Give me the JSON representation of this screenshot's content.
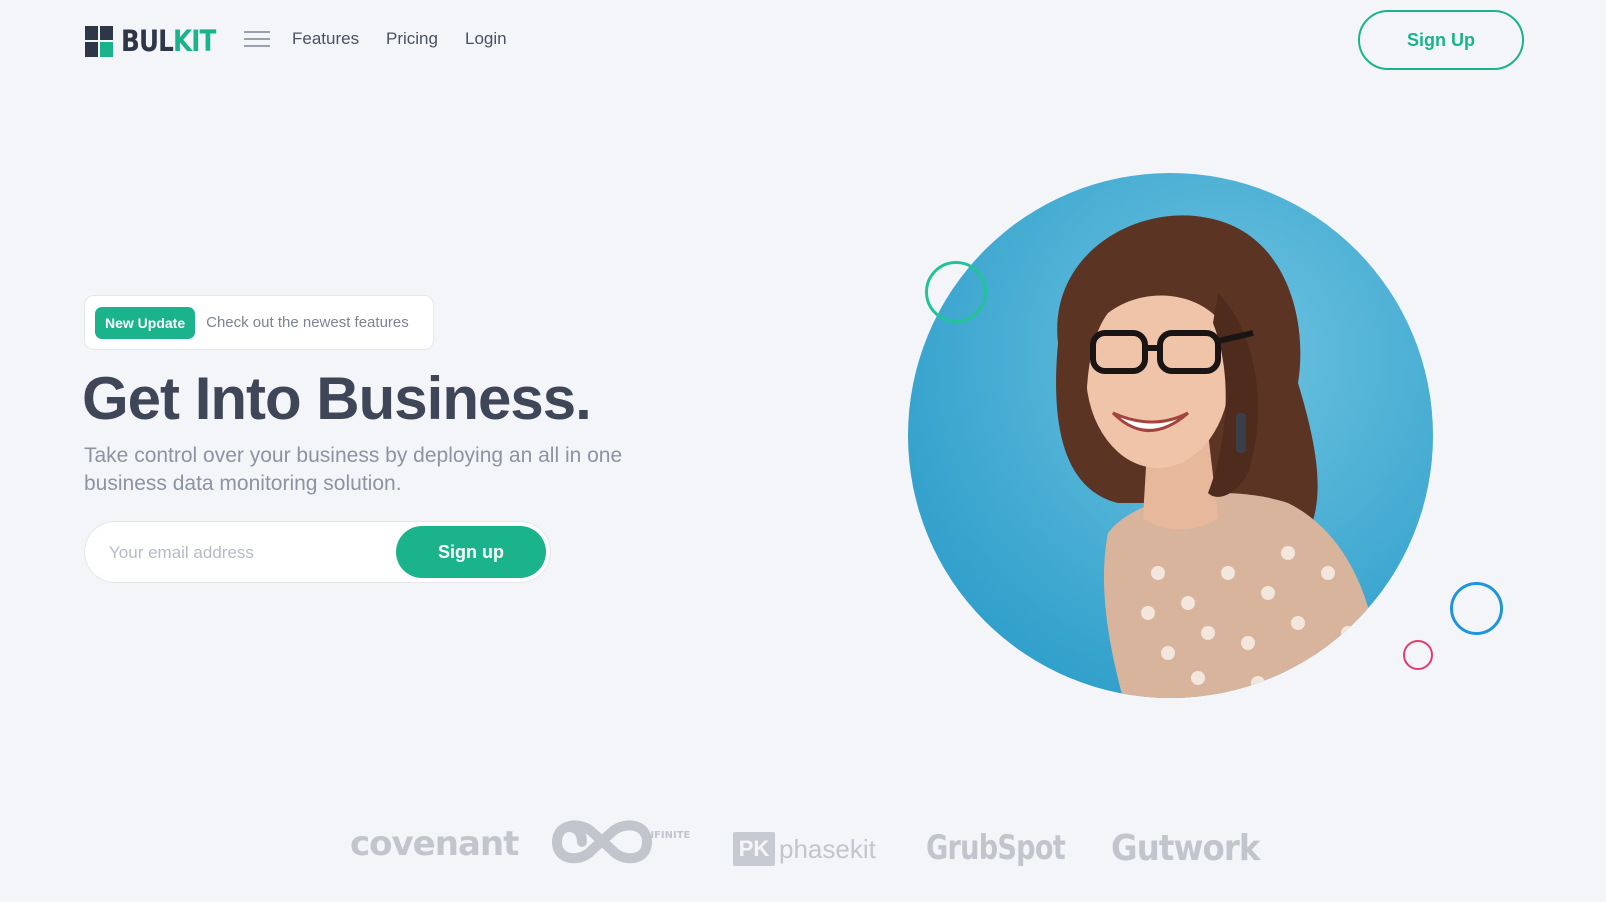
{
  "brand": {
    "name_part1": "BUL",
    "name_part2": "KIT"
  },
  "nav": {
    "links": [
      {
        "label": "Features"
      },
      {
        "label": "Pricing"
      },
      {
        "label": "Login"
      }
    ],
    "signup_label": "Sign Up"
  },
  "hero": {
    "badge": "New Update",
    "badge_text": "Check out the newest features",
    "title": "Get Into Business.",
    "subtitle": "Take control over your business by deploying an all in one business data monitoring solution.",
    "email_placeholder": "Your email address",
    "cta_label": "Sign up"
  },
  "clients": {
    "covenant": "covenant",
    "infinite": "INFINITE",
    "phasekit_mark": "PK",
    "phasekit": "phasekit",
    "grubspot": "GrubSpot",
    "gutwork": "Gutwork"
  },
  "colors": {
    "accent": "#1ab38b",
    "text_dark": "#3e4657",
    "background": "#f4f5f9",
    "ring_blue": "#2294d9",
    "ring_pink": "#e23d6e"
  }
}
